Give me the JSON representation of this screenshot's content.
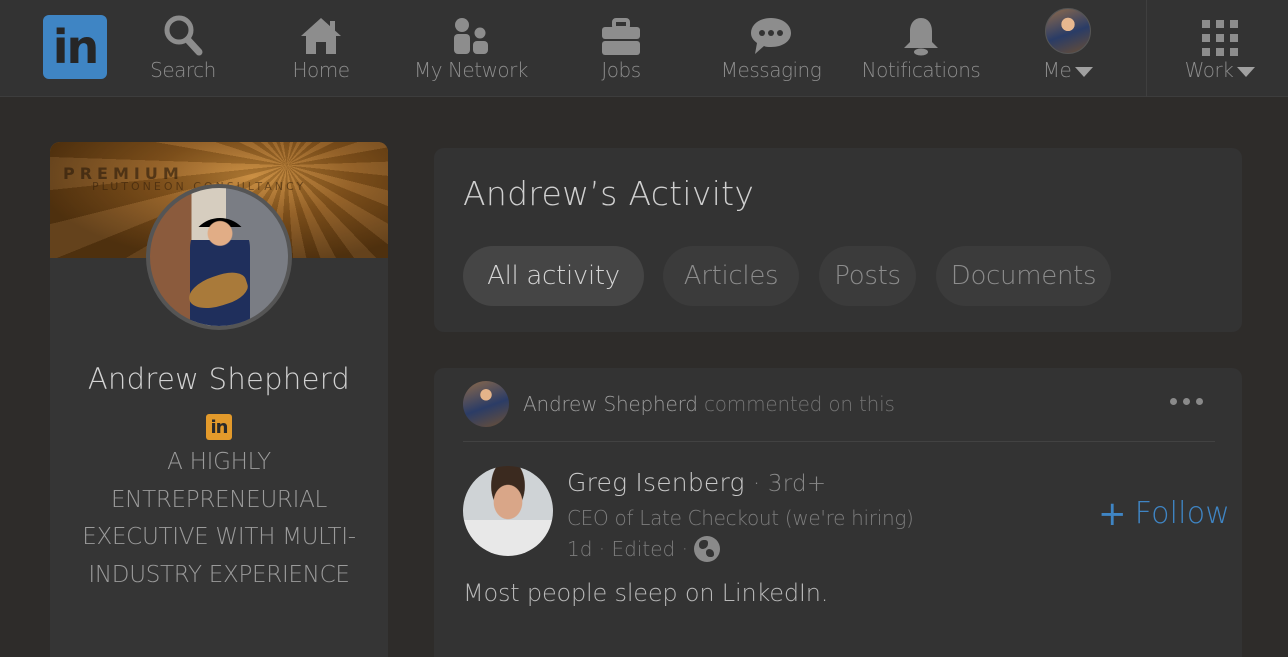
{
  "nav": {
    "logo": "in",
    "items": [
      {
        "label": "Search",
        "icon": "search-icon"
      },
      {
        "label": "Home",
        "icon": "home-icon"
      },
      {
        "label": "My Network",
        "icon": "network-icon"
      },
      {
        "label": "Jobs",
        "icon": "briefcase-icon"
      },
      {
        "label": "Messaging",
        "icon": "messaging-icon"
      },
      {
        "label": "Notifications",
        "icon": "bell-icon"
      },
      {
        "label": "Me",
        "icon": "avatar"
      },
      {
        "label": "Work",
        "icon": "grid-icon"
      }
    ],
    "accent": "#3f85c4",
    "icon_color": "#8d8d8d"
  },
  "profile": {
    "banner_text": "PREMIUM",
    "banner_subtext": "PLUTONEON CONSULTANCY",
    "name": "Andrew Shepherd",
    "badge": "in",
    "badge_color": "#e39a2b",
    "headline": "A HIGHLY ENTREPRENEURIAL EXECUTIVE WITH MULTI-INDUSTRY EXPERIENCE"
  },
  "activity": {
    "title": "Andrew’s Activity",
    "filters": [
      {
        "label": "All activity",
        "active": true
      },
      {
        "label": "Articles",
        "active": false
      },
      {
        "label": "Posts",
        "active": false
      },
      {
        "label": "Documents",
        "active": false
      }
    ]
  },
  "post": {
    "actor": "Andrew Shepherd",
    "action": "commented on this",
    "author": {
      "name": "Greg Isenberg",
      "degree": "· 3rd+",
      "title": "CEO of Late Checkout (we're hiring)",
      "meta": "1d · Edited ·"
    },
    "follow_label": "Follow",
    "text": "Most people sleep on LinkedIn."
  }
}
